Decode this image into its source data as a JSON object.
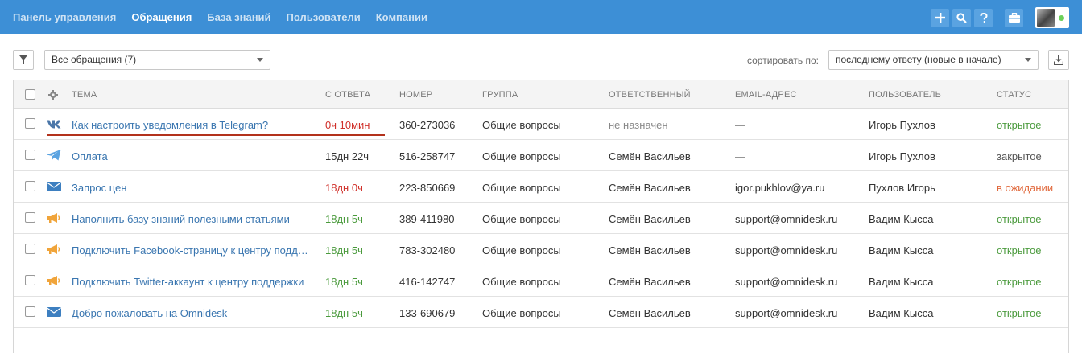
{
  "nav": {
    "items": [
      {
        "label": "Панель управления",
        "active": false
      },
      {
        "label": "Обращения",
        "active": true
      },
      {
        "label": "База знаний",
        "active": false
      },
      {
        "label": "Пользователи",
        "active": false
      },
      {
        "label": "Компании",
        "active": false
      }
    ]
  },
  "toolbar": {
    "filter_value": "Все обращения (7)",
    "sort_label": "сортировать по:",
    "sort_value": "последнему ответу (новые в начале)"
  },
  "table": {
    "headers": {
      "subject": "ТЕМА",
      "since_reply": "С ОТВЕТА",
      "number": "НОМЕР",
      "group": "ГРУППА",
      "assignee": "ОТВЕТСТВЕННЫЙ",
      "email": "EMAIL-АДРЕС",
      "user": "ПОЛЬЗОВАТЕЛЬ",
      "status": "СТАТУС"
    },
    "rows": [
      {
        "channel": "vk-icon",
        "subject": "Как настроить уведомления в Telegram?",
        "since": "0ч 10мин",
        "since_color": "red",
        "number": "360-273036",
        "group": "Общие вопросы",
        "assignee": "не назначен",
        "assignee_muted": true,
        "email": "—",
        "user": "Игорь Пухлов",
        "status": "открытое",
        "status_kind": "open"
      },
      {
        "channel": "telegram-icon",
        "subject": "Оплата",
        "since": "15дн 22ч",
        "since_color": "normal",
        "number": "516-258747",
        "group": "Общие вопросы",
        "assignee": "Семён Васильев",
        "assignee_muted": false,
        "email": "—",
        "user": "Игорь Пухлов",
        "status": "закрытое",
        "status_kind": "closed"
      },
      {
        "channel": "email-icon",
        "subject": "Запрос цен",
        "since": "18дн 0ч",
        "since_color": "red",
        "number": "223-850669",
        "group": "Общие вопросы",
        "assignee": "Семён Васильев",
        "assignee_muted": false,
        "email": "igor.pukhlov@ya.ru",
        "user": "Пухлов Игорь",
        "status": "в ожидании",
        "status_kind": "wait"
      },
      {
        "channel": "megaphone-icon",
        "subject": "Наполнить базу знаний полезными статьями",
        "since": "18дн 5ч",
        "since_color": "green",
        "number": "389-411980",
        "group": "Общие вопросы",
        "assignee": "Семён Васильев",
        "assignee_muted": false,
        "email": "support@omnidesk.ru",
        "user": "Вадим Кысса",
        "status": "открытое",
        "status_kind": "open"
      },
      {
        "channel": "megaphone-icon",
        "subject": "Подключить Facebook-страницу к центру поддержки",
        "since": "18дн 5ч",
        "since_color": "green",
        "number": "783-302480",
        "group": "Общие вопросы",
        "assignee": "Семён Васильев",
        "assignee_muted": false,
        "email": "support@omnidesk.ru",
        "user": "Вадим Кысса",
        "status": "открытое",
        "status_kind": "open"
      },
      {
        "channel": "megaphone-icon",
        "subject": "Подключить Twitter-аккаунт к центру поддержки",
        "since": "18дн 5ч",
        "since_color": "green",
        "number": "416-142747",
        "group": "Общие вопросы",
        "assignee": "Семён Васильев",
        "assignee_muted": false,
        "email": "support@omnidesk.ru",
        "user": "Вадим Кысса",
        "status": "открытое",
        "status_kind": "open"
      },
      {
        "channel": "email-icon",
        "subject": "Добро пожаловать на Omnidesk",
        "since": "18дн 5ч",
        "since_color": "green",
        "number": "133-690679",
        "group": "Общие вопросы",
        "assignee": "Семён Васильев",
        "assignee_muted": false,
        "email": "support@omnidesk.ru",
        "user": "Вадим Кысса",
        "status": "открытое",
        "status_kind": "open"
      }
    ]
  },
  "colors": {
    "topbar": "#3d8fd6",
    "link": "#3a76b0",
    "red": "#d0302a",
    "green": "#4a9a3c",
    "orange": "#e0673a"
  }
}
